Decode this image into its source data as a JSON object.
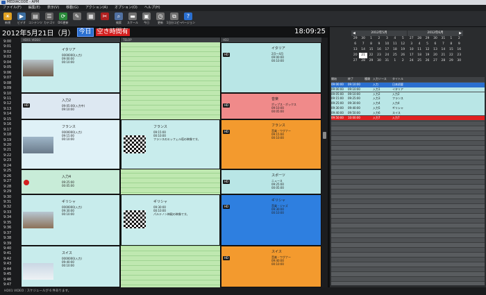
{
  "window": {
    "title": "MEDIACODE - APM"
  },
  "menu": [
    "ファイル(F)",
    "編集(E)",
    "表示(V)",
    "移動(G)",
    "アクション(A)",
    "オプション(O)",
    "ヘルプ(H)"
  ],
  "toolbar": [
    {
      "label": "新規",
      "icon": "sun-icon",
      "color": "#e0a020"
    },
    {
      "label": "ビデオ",
      "icon": "video-icon",
      "color": "#3c6ea0"
    },
    {
      "label": "コンテンツ",
      "icon": "content-icon",
      "color": "#606060"
    },
    {
      "label": "カテゴリ",
      "icon": "category-icon",
      "color": "#606060"
    },
    {
      "label": "DIG更新",
      "icon": "refresh-icon",
      "color": "#2a8a3a"
    },
    {
      "label": "",
      "icon": "tool-icon",
      "color": "#707070"
    },
    {
      "label": "",
      "icon": "grid-icon",
      "color": "#707070"
    },
    {
      "label": "",
      "icon": "cut-icon",
      "color": "#b02020"
    },
    {
      "label": "検索",
      "icon": "search-icon",
      "color": "#5070a0"
    },
    {
      "label": "スケール",
      "icon": "scale-icon",
      "color": "#707070"
    },
    {
      "label": "今日",
      "icon": "calendar-icon",
      "color": "#707070"
    },
    {
      "label": "更新",
      "icon": "clock-icon",
      "color": "#707070"
    },
    {
      "label": "1日分コピー",
      "icon": "copy-icon",
      "color": "#707070"
    },
    {
      "label": "バージョン",
      "icon": "help-icon",
      "color": "#2a6fd0"
    }
  ],
  "datebar": {
    "date": "2012年5月21日（月）",
    "today": "今日",
    "free": "空き時間有",
    "clock": "18:09:25"
  },
  "times": [
    "9:00",
    "9:01",
    "9:02",
    "9:03",
    "9:04",
    "9:05",
    "9:06",
    "9:07",
    "9:08",
    "9:09",
    "9:10",
    "9:11",
    "9:12",
    "9:13",
    "9:14",
    "9:15",
    "9:16",
    "9:17",
    "9:18",
    "9:19",
    "9:20",
    "9:21",
    "9:22",
    "9:23",
    "9:24",
    "9:25",
    "9:26",
    "9:27",
    "9:28",
    "9:29",
    "9:30",
    "9:31",
    "9:32",
    "9:33",
    "9:34",
    "9:35",
    "9:36",
    "9:37",
    "9:38",
    "9:39",
    "9:40",
    "9:41",
    "9:42",
    "9:43",
    "9:44",
    "9:45",
    "9:46",
    "9:47"
  ],
  "columns": [
    "HD01 VIDEO",
    "TELOP",
    "HD2"
  ],
  "col1_blocks": [
    {
      "title": "イタリア",
      "details": "0000000(入力)\n09:00:00\n00:10:00",
      "kind": "roma"
    },
    {
      "title": "入力2",
      "details": "09:05:00(入力中)\n09:10:00",
      "kind": "tag"
    },
    {
      "title": "フランス",
      "details": "0000000(入力)\n09:15:00\n00:10:00",
      "kind": "eiffel"
    },
    {
      "title": "入力4",
      "details": "09:25:00\n00:05:00",
      "kind": "red"
    },
    {
      "title": "ギリシャ",
      "details": "0000000(入力)\n09:30:00\n00:10:00",
      "kind": "greece"
    },
    {
      "title": "スイス",
      "details": "0000000(入力)\n09:40:00\n00:10:00",
      "kind": "mountain"
    }
  ],
  "col2_blocks": [
    {
      "title": "フランス",
      "details": "09:15:00\n00:10:00\nフランスのエッフェル塔の映像です。"
    },
    {
      "title": "ギリシャ",
      "details": "09:30:00\n00:10:00\nパルテノン神殿の映像です。"
    }
  ],
  "col3_blocks": [
    {
      "title": "イタリア",
      "details": "2月〜4月\n09:00:00\n00:10:00",
      "color": "#b9e6e6"
    },
    {
      "title": "音楽",
      "details": "ポップス・ボックス\n09:10:00\n00:05:00",
      "color": "#f08a8a"
    },
    {
      "title": "フランス",
      "details": "音楽・ワグナー\n09:15:00\n00:10:00",
      "color": "#f39a2e"
    },
    {
      "title": "スポーツ",
      "details": "ニュース\n09:25:00\n00:05:00",
      "color": "#b9e6e6"
    },
    {
      "title": "ギリシャ",
      "details": "音楽・ジャズ\n09:30:00\n00:10:00",
      "color": "#2e7fe0"
    },
    {
      "title": "スイス",
      "details": "音楽・ワグナー\n09:40:00\n00:10:00",
      "color": "#f39a2e"
    }
  ],
  "calendars": [
    {
      "title": "2012年5月",
      "days": [
        "29",
        "30",
        "1",
        "2",
        "3",
        "4",
        "5",
        "6",
        "7",
        "8",
        "9",
        "10",
        "11",
        "12",
        "13",
        "14",
        "15",
        "16",
        "17",
        "18",
        "19",
        "20",
        "21",
        "22",
        "23",
        "24",
        "25",
        "26",
        "27",
        "28",
        "29",
        "30",
        "31",
        "1",
        "2"
      ],
      "selected": "21"
    },
    {
      "title": "2012年6月",
      "days": [
        "27",
        "28",
        "29",
        "30",
        "31",
        "1",
        "2",
        "3",
        "4",
        "5",
        "6",
        "7",
        "8",
        "9",
        "10",
        "11",
        "12",
        "13",
        "14",
        "15",
        "16",
        "17",
        "18",
        "19",
        "20",
        "21",
        "22",
        "23",
        "24",
        "25",
        "26",
        "27",
        "28",
        "29",
        "30"
      ],
      "selected": ""
    }
  ],
  "list_headers": [
    "開始",
    "終了",
    "種類",
    "入力ソース",
    "タイトル"
  ],
  "list_rows": [
    {
      "start": "09:00:00",
      "end": "09:10:00",
      "src": "入力",
      "title": "日本初夏",
      "color": "#2a6fd0"
    },
    {
      "start": "09:00:00",
      "end": "09:10:00",
      "src": "入力1",
      "title": "イタリア",
      "color": "#b9e6e6"
    },
    {
      "start": "09:05:00",
      "end": "09:10:00",
      "src": "入力2",
      "title": "入力2",
      "color": "#b9e6e6"
    },
    {
      "start": "09:15:00",
      "end": "09:25:00",
      "src": "入力3",
      "title": "フランス",
      "color": "#b9e6e6"
    },
    {
      "start": "09:25:00",
      "end": "09:30:00",
      "src": "入力4",
      "title": "入力4",
      "color": "#b9e6e6"
    },
    {
      "start": "09:30:00",
      "end": "09:40:00",
      "src": "入力5",
      "title": "ギリシャ",
      "color": "#b9e6e6"
    },
    {
      "start": "09:40:00",
      "end": "09:50:00",
      "src": "入力6",
      "title": "スイス",
      "color": "#b9e6e6"
    },
    {
      "start": "09:50:00",
      "end": "10:00:00",
      "src": "入力7",
      "title": "入力7",
      "color": "#e02020"
    }
  ],
  "status": "HD01 VIDEO : スケジュールが 6 件あります。"
}
